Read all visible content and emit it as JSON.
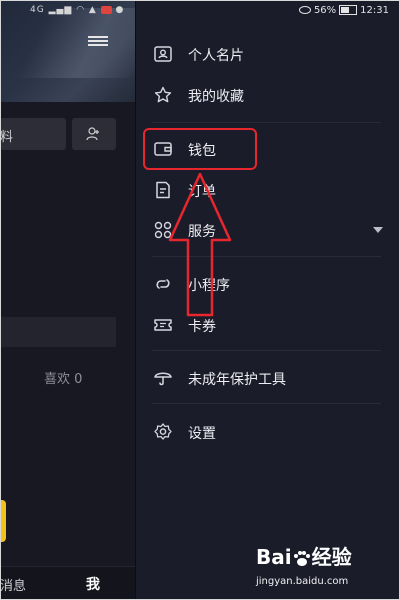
{
  "status_bar": {
    "left_text": "4G",
    "battery": "56%",
    "time": "12:31"
  },
  "left_pane": {
    "edit_profile_label": "料",
    "likes_label": "喜欢 0",
    "bottom_nav": {
      "messages": "消息",
      "me": "我"
    }
  },
  "drawer": {
    "items": [
      {
        "label": "个人名片",
        "icon": "id-card-icon"
      },
      {
        "label": "我的收藏",
        "icon": "star-icon"
      },
      {
        "label": "钱包",
        "icon": "wallet-icon"
      },
      {
        "label": "订单",
        "icon": "order-icon"
      },
      {
        "label": "服务",
        "icon": "grid-services-icon"
      },
      {
        "label": "小程序",
        "icon": "mini-program-icon"
      },
      {
        "label": "卡券",
        "icon": "coupon-icon"
      },
      {
        "label": "未成年保护工具",
        "icon": "umbrella-icon"
      },
      {
        "label": "设置",
        "icon": "gear-icon"
      }
    ]
  },
  "annotation": {
    "highlight_color": "#e8262d"
  },
  "watermark": {
    "brand_text": "Bai",
    "brand_suffix": "经验",
    "url": "jingyan.baidu.com"
  }
}
